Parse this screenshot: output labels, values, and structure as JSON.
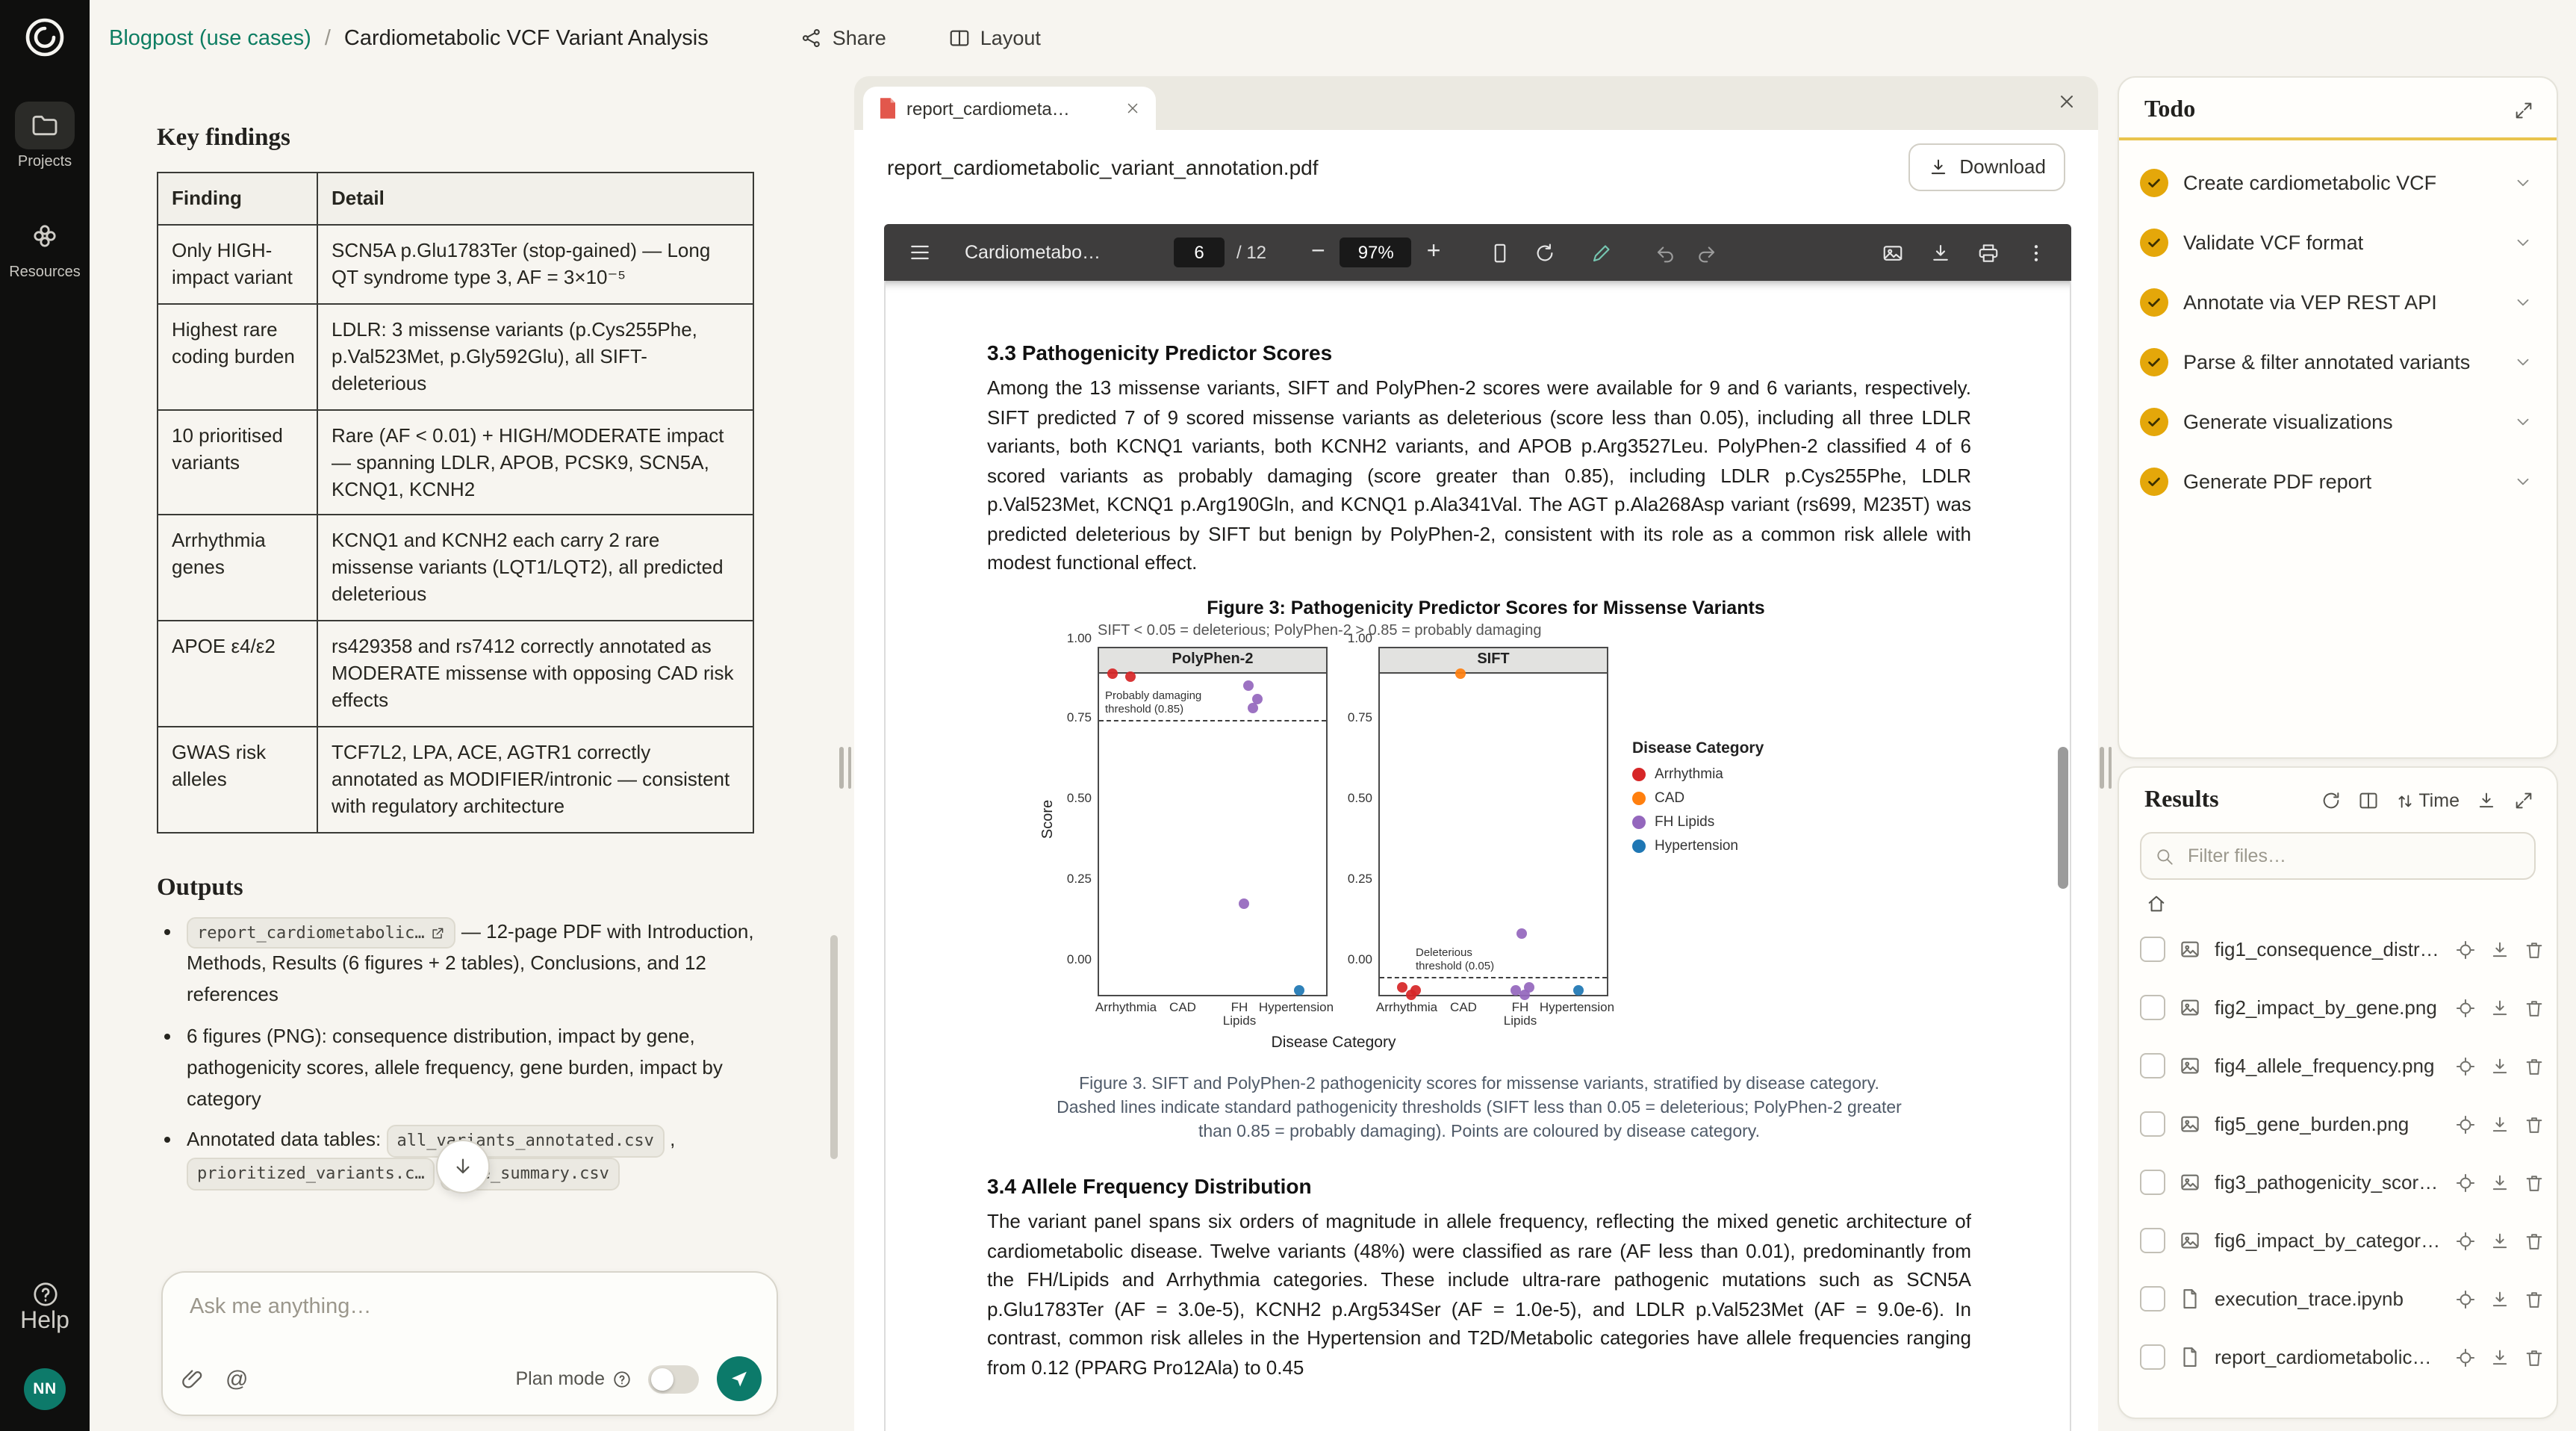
{
  "topbar": {
    "breadcrumb_project": "Blogpost (use cases)",
    "breadcrumb_separator": "/",
    "breadcrumb_page": "Cardiometabolic VCF Variant Analysis",
    "share_label": "Share",
    "layout_label": "Layout"
  },
  "sidebar": {
    "projects_label": "Projects",
    "resources_label": "Resources",
    "help_label": "Help",
    "avatar_initials": "NN"
  },
  "left_panel": {
    "key_findings_title": "Key findings",
    "table": {
      "headers": [
        "Finding",
        "Detail"
      ],
      "rows": [
        {
          "finding": "Only HIGH-impact variant",
          "detail": "SCN5A p.Glu1783Ter (stop-gained) — Long QT syndrome type 3, AF = 3×10⁻⁵"
        },
        {
          "finding": "Highest rare coding burden",
          "detail": "LDLR: 3 missense variants (p.Cys255Phe, p.Val523Met, p.Gly592Glu), all SIFT-deleterious"
        },
        {
          "finding": "10 prioritised variants",
          "detail": "Rare (AF < 0.01) + HIGH/MODERATE impact — spanning LDLR, APOB, PCSK9, SCN5A, KCNQ1, KCNH2"
        },
        {
          "finding": "Arrhythmia genes",
          "detail": "KCNQ1 and KCNH2 each carry 2 rare missense variants (LQT1/LQT2), all predicted deleterious"
        },
        {
          "finding": "APOE ε4/ε2",
          "detail": "rs429358 and rs7412 correctly annotated as MODERATE missense with opposing CAD risk effects"
        },
        {
          "finding": "GWAS risk alleles",
          "detail": "TCF7L2, LPA, ACE, AGTR1 correctly annotated as MODIFIER/intronic — consistent with regulatory architecture"
        }
      ]
    },
    "outputs_title": "Outputs",
    "outputs": {
      "item1_chip": "report_cardiometabolic…",
      "item1_text": "— 12-page PDF with Introduction, Methods, Results (6 figures + 2 tables), Conclusions, and 12 references",
      "item2_text": "6 figures (PNG): consequence distribution, impact by gene, pathogenicity scores, allele frequency, gene burden, impact by category",
      "item3_prefix": "Annotated data tables:",
      "item3_chip1": "all_variants_annotated.csv",
      "item3_comma": ",",
      "item3_chip2": "prioritized_variants.c…",
      "item3_chip3": "gene_summary.csv"
    },
    "chat": {
      "placeholder": "Ask me anything…",
      "at_symbol": "@",
      "plan_mode_label": "Plan mode"
    }
  },
  "center_panel": {
    "tab_label": "report_cardiometa…",
    "file_title": "report_cardiometabolic_variant_annotation.pdf",
    "download_label": "Download",
    "toolbar": {
      "doc_title": "Cardiometabo…",
      "page_number": "6",
      "page_total": "/ 12",
      "zoom_out": "−",
      "zoom_level": "97%",
      "zoom_in": "+"
    },
    "pdf": {
      "section33_title": "3.3 Pathogenicity Predictor Scores",
      "section33_body": "Among the 13 missense variants, SIFT and PolyPhen-2 scores were available for 9 and 6 variants, respectively. SIFT predicted 7 of 9 scored missense variants as deleterious (score less than 0.05), including all three LDLR variants, both KCNQ1 variants, both KCNH2 variants, and APOB p.Arg3527Leu. PolyPhen-2 classified 4 of 6 scored variants as probably damaging (score greater than 0.85), including LDLR p.Cys255Phe, LDLR p.Val523Met, KCNQ1 p.Arg190Gln, and KCNQ1 p.Ala341Val. The AGT p.Ala268Asp variant (rs699, M235T) was predicted deleterious by SIFT but benign by PolyPhen-2, consistent with its role as a common risk allele with modest functional effect.",
      "figure_caption": "Figure 3. SIFT and PolyPhen-2 pathogenicity scores for missense variants, stratified by disease category. Dashed lines indicate standard pathogenicity thresholds (SIFT less than 0.05 = deleterious; PolyPhen-2 greater than 0.85 = probably damaging). Points are coloured by disease category.",
      "section34_title": "3.4 Allele Frequency Distribution",
      "section34_body": "The variant panel spans six orders of magnitude in allele frequency, reflecting the mixed genetic architecture of cardiometabolic disease. Twelve variants (48%) were classified as rare (AF less than 0.01), predominantly from the FH/Lipids and Arrhythmia categories. These include ultra-rare pathogenic mutations such as SCN5A p.Glu1783Ter (AF = 3.0e-5), KCNH2 p.Arg534Ser (AF = 1.0e-5), and LDLR p.Val523Met (AF = 9.0e-6). In contrast, common risk alleles in the Hypertension and T2D/Metabolic categories have allele frequencies ranging from 0.12 (PPARG Pro12Ala) to 0.45"
    }
  },
  "chart_data": {
    "type": "scatter",
    "title": "Figure 3: Pathogenicity Predictor Scores for Missense Variants",
    "subtitle": "SIFT < 0.05 = deleterious; PolyPhen-2 > 0.85 = probably damaging",
    "xlabel": "Disease Category",
    "ylabel": "Score",
    "ylim": [
      0,
      1
    ],
    "yticks": [
      "1.00",
      "0.75",
      "0.50",
      "0.25",
      "0.00"
    ],
    "categories": [
      "Arrhythmia",
      "CAD",
      "FH Lipids",
      "Hypertension"
    ],
    "legend": {
      "title": "Disease Category",
      "entries": [
        {
          "label": "Arrhythmia",
          "color": "#d62728"
        },
        {
          "label": "CAD",
          "color": "#ff7f0e"
        },
        {
          "label": "FH Lipids",
          "color": "#9467bd"
        },
        {
          "label": "Hypertension",
          "color": "#1f77b4"
        }
      ]
    },
    "panels": [
      {
        "name": "PolyPhen-2",
        "threshold": {
          "value": 0.85,
          "label_lines": [
            "Probably damaging",
            "threshold (0.85)"
          ],
          "label_x": 4
        },
        "points": [
          {
            "category": "Arrhythmia",
            "value": 1.0,
            "jitter": -0.065
          },
          {
            "category": "Arrhythmia",
            "value": 0.99,
            "jitter": 0.01
          },
          {
            "category": "FH Lipids",
            "value": 0.96,
            "jitter": 0.035
          },
          {
            "category": "FH Lipids",
            "value": 0.92,
            "jitter": 0.075
          },
          {
            "category": "FH Lipids",
            "value": 0.89,
            "jitter": 0.055
          },
          {
            "category": "FH Lipids",
            "value": 0.28,
            "jitter": 0.015
          },
          {
            "category": "Hypertension",
            "value": 0.01,
            "jitter": 0.005
          }
        ]
      },
      {
        "name": "SIFT",
        "threshold": {
          "value": 0.05,
          "label_lines": [
            "Deleterious",
            "threshold (0.05)"
          ],
          "label_x": 24
        },
        "points": [
          {
            "category": "CAD",
            "value": 1.0,
            "jitter": -0.02
          },
          {
            "category": "Arrhythmia",
            "value": 0.02,
            "jitter": -0.025
          },
          {
            "category": "Arrhythmia",
            "value": 0.0,
            "jitter": 0.01
          },
          {
            "category": "Arrhythmia",
            "value": 0.01,
            "jitter": 0.035
          },
          {
            "category": "FH Lipids",
            "value": 0.19,
            "jitter": 0.0
          },
          {
            "category": "FH Lipids",
            "value": 0.01,
            "jitter": -0.025
          },
          {
            "category": "FH Lipids",
            "value": 0.0,
            "jitter": 0.01
          },
          {
            "category": "FH Lipids",
            "value": 0.02,
            "jitter": 0.035
          },
          {
            "category": "Hypertension",
            "value": 0.01,
            "jitter": 0.0
          }
        ]
      }
    ]
  },
  "right_panel": {
    "todo": {
      "title": "Todo",
      "items": [
        "Create cardiometabolic VCF",
        "Validate VCF format",
        "Annotate via VEP REST API",
        "Parse & filter annotated variants",
        "Generate visualizations",
        "Generate PDF report"
      ]
    },
    "results": {
      "title": "Results",
      "sort_label": "Time",
      "filter_placeholder": "Filter files…",
      "files": [
        {
          "name": "fig1_consequence_distrib…",
          "kind": "image"
        },
        {
          "name": "fig2_impact_by_gene.png",
          "kind": "image"
        },
        {
          "name": "fig4_allele_frequency.png",
          "kind": "image"
        },
        {
          "name": "fig5_gene_burden.png",
          "kind": "image"
        },
        {
          "name": "fig3_pathogenicity_score…",
          "kind": "image"
        },
        {
          "name": "fig6_impact_by_category….",
          "kind": "image"
        },
        {
          "name": "execution_trace.ipynb",
          "kind": "notebook"
        },
        {
          "name": "report_cardiometabolic_v…",
          "kind": "document"
        }
      ]
    }
  }
}
